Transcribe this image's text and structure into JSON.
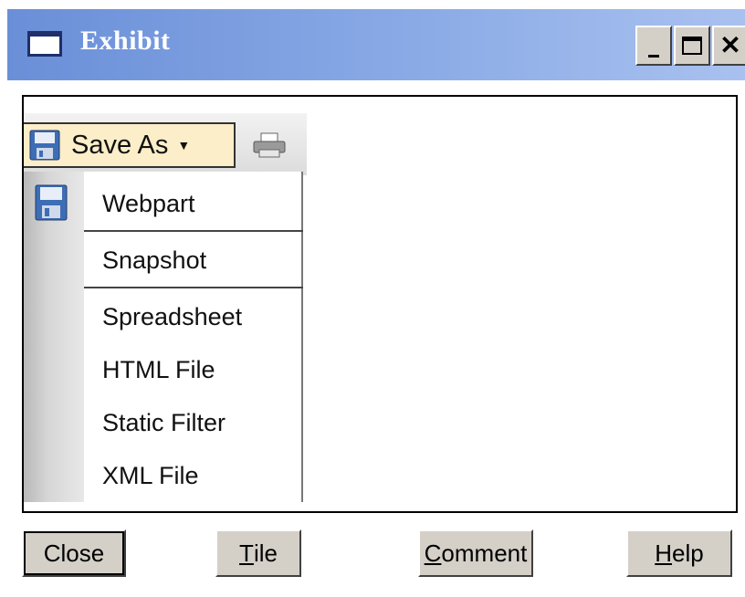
{
  "window": {
    "title": "Exhibit"
  },
  "titlebar_buttons": {
    "minimize": "_",
    "maximize": "□",
    "close": "✕"
  },
  "toolbar": {
    "save_as_label": "Save As",
    "caret": "▼"
  },
  "menu": {
    "items": [
      {
        "label": "Webpart"
      },
      {
        "label": "Snapshot"
      },
      {
        "label": "Spreadsheet"
      },
      {
        "label": "HTML File"
      },
      {
        "label": "Static Filter"
      },
      {
        "label": "XML File"
      }
    ]
  },
  "buttons": {
    "close": "Close",
    "tile_rest": "ile",
    "tile_mnemonic": "T",
    "comment_rest": "omment",
    "comment_mnemonic": "C",
    "help_rest": "elp",
    "help_mnemonic": "H"
  },
  "icons": {
    "window": "window-icon",
    "save": "floppy-disk-icon",
    "print": "printer-icon"
  },
  "colors": {
    "titlebar": "#6a8fd8",
    "button_face": "#d4d0c8",
    "save_as_highlight": "#fbeec8"
  }
}
